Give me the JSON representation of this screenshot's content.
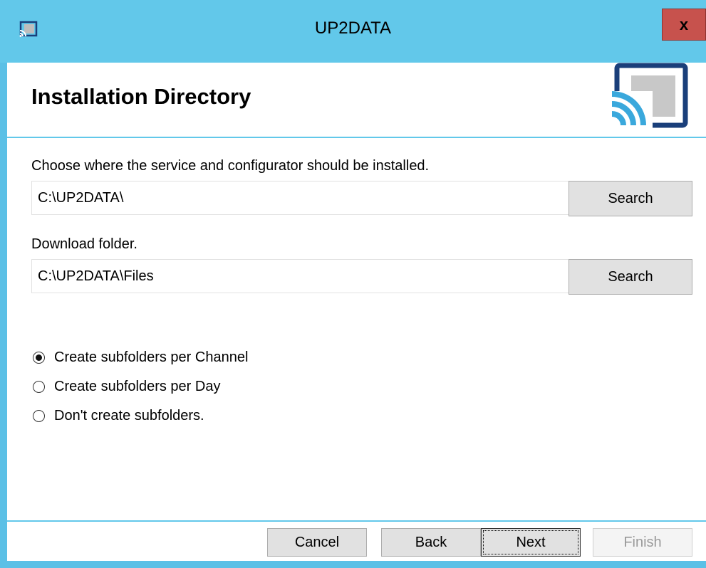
{
  "window": {
    "title": "UP2DATA",
    "close_label": "x",
    "accent": "#62c8ea",
    "logo_dark": "#1a3f7a",
    "logo_blue": "#3aa8dc"
  },
  "header": {
    "title": "Installation Directory"
  },
  "install": {
    "label": "Choose where the service and configurator should be installed.",
    "path": "C:\\UP2DATA\\",
    "search_label": "Search"
  },
  "download": {
    "label": "Download folder.",
    "path": "C:\\UP2DATA\\Files",
    "search_label": "Search"
  },
  "subfolders": {
    "options": [
      {
        "label": "Create subfolders per Channel",
        "selected": true
      },
      {
        "label": "Create subfolders per Day",
        "selected": false
      },
      {
        "label": "Don't create subfolders.",
        "selected": false
      }
    ]
  },
  "footer": {
    "cancel_label": "Cancel",
    "back_label": "Back",
    "next_label": "Next",
    "finish_label": "Finish"
  }
}
